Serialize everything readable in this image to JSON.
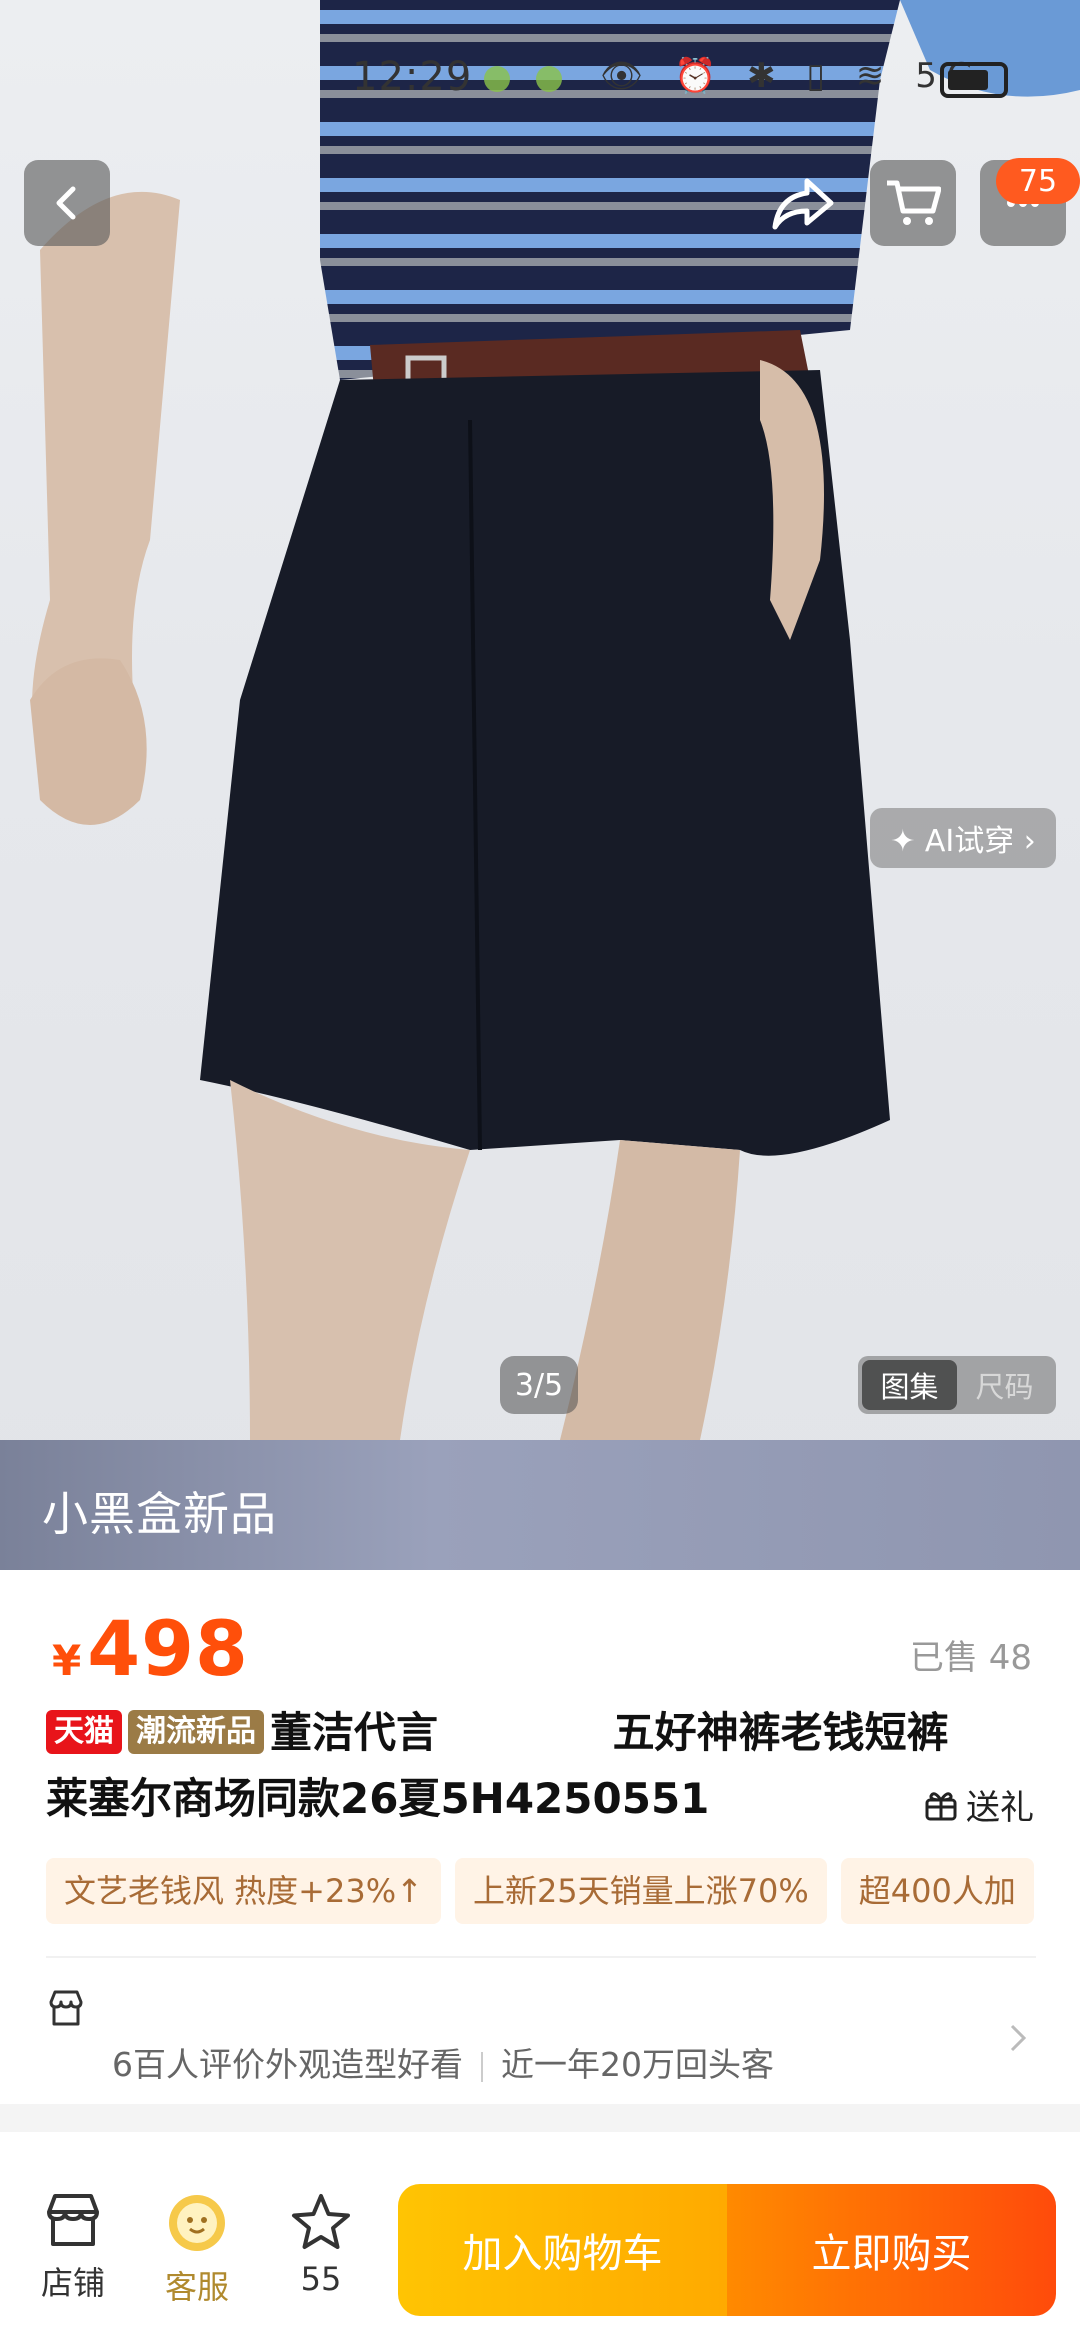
{
  "status_bar": {
    "time": "12:29",
    "network": "5G"
  },
  "hero": {
    "cart_badge": "75",
    "ai_try_label": "✦ AI试穿 ›",
    "image_counter": "3/5",
    "segments": [
      "图集",
      "尺码"
    ],
    "brand_banner": "小黑盒新品"
  },
  "product": {
    "currency": "¥",
    "price": "498",
    "sold": "已售 48",
    "tags": [
      "天猫",
      "潮流新品"
    ],
    "title_line1": "董洁代言 ",
    "title_line1b": "五好神裤老钱短裤",
    "title_line2": "莱塞尔商场同款26夏5H4250551",
    "gift_label": "送礼",
    "chips": [
      "文艺老钱风 热度+23%↑",
      "上新25天销量上涨70%",
      "超400人加"
    ]
  },
  "store": {
    "name": "",
    "review_summary": "6百人评价外观造型好看",
    "repeat_customers": "近一年20万回头客"
  },
  "bottom_bar": {
    "store_label": "店铺",
    "service_label": "客服",
    "favorite_count": "55",
    "add_to_cart": "加入购物车",
    "buy_now": "立即购买"
  },
  "colors": {
    "price": "#ff4f0a",
    "tmall": "#e8141a",
    "trend_tag": "#9b7b46",
    "add_cart": "#ffb800",
    "buy_now": "#ff5a0a"
  }
}
